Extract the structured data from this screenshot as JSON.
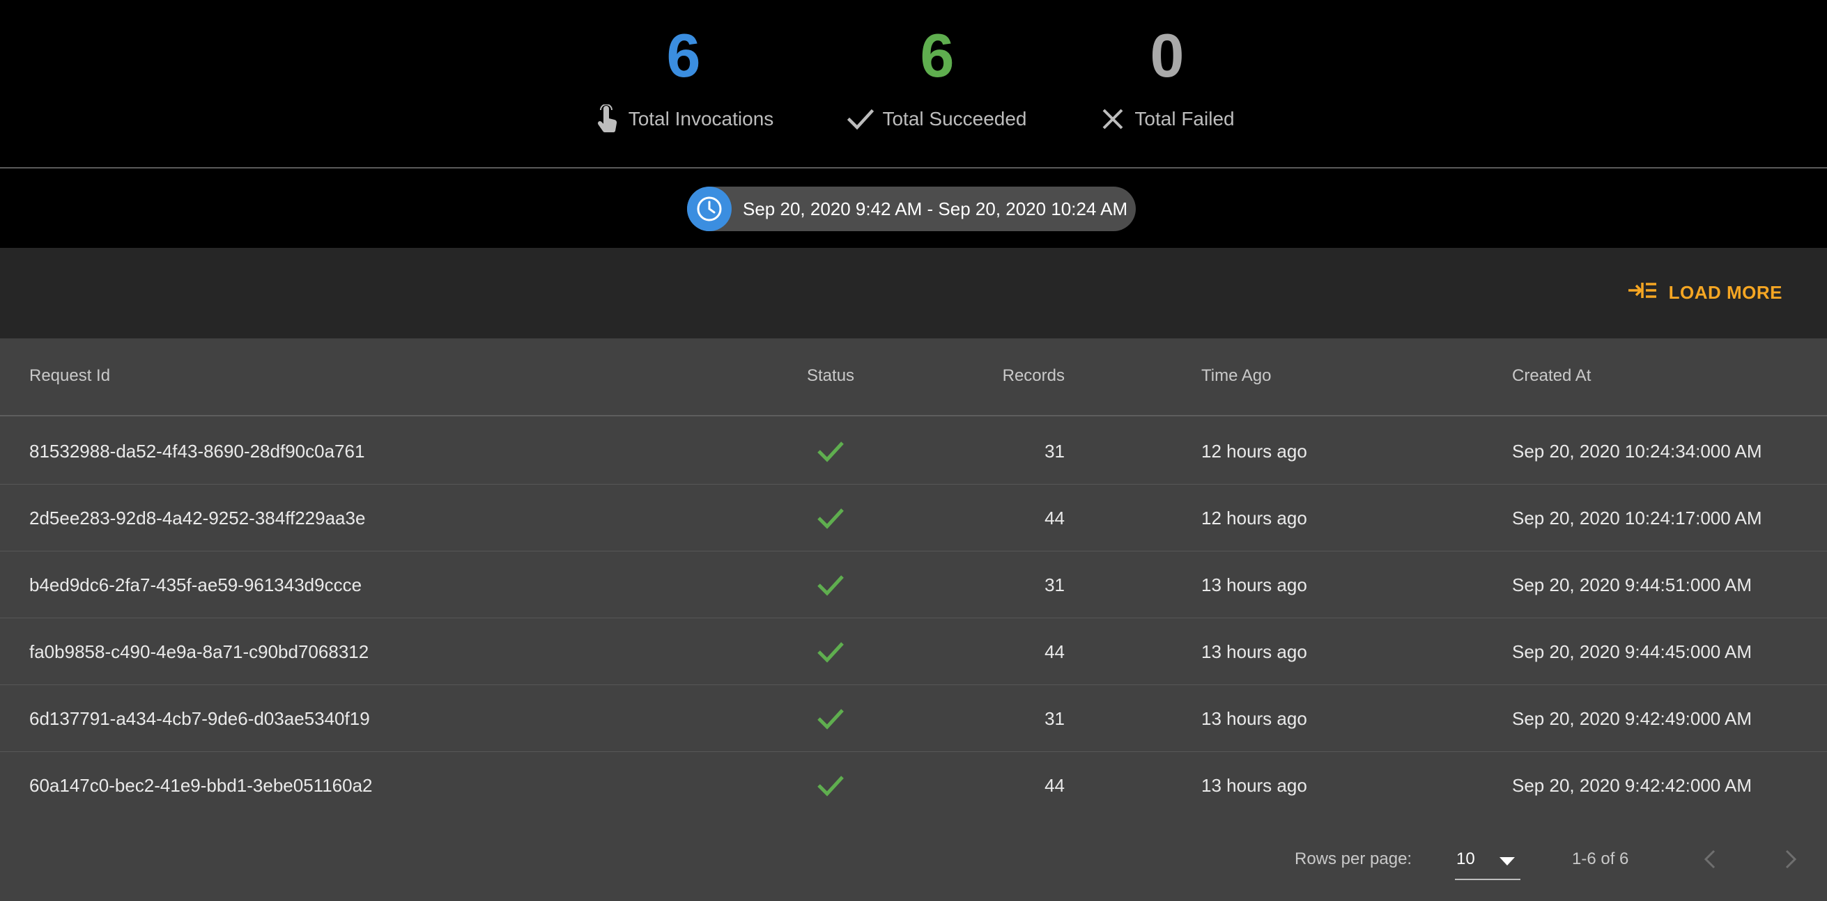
{
  "stats": {
    "invocations": {
      "value": "6",
      "label": "Total Invocations",
      "icon": "touch-icon",
      "color": "#3b8ee0"
    },
    "succeeded": {
      "value": "6",
      "label": "Total Succeeded",
      "icon": "check-icon",
      "color": "#5fae4f"
    },
    "failed": {
      "value": "0",
      "label": "Total Failed",
      "icon": "close-icon",
      "color": "#bdbdbd"
    }
  },
  "date_range": {
    "text": "Sep 20, 2020 9:42 AM - Sep 20, 2020 10:24 AM",
    "icon": "clock-icon"
  },
  "toolbar": {
    "load_more_label": "LOAD MORE",
    "icon": "load-more-icon",
    "accent": "#f5a623"
  },
  "table": {
    "headers": {
      "request_id": "Request Id",
      "status": "Status",
      "records": "Records",
      "time_ago": "Time Ago",
      "created_at": "Created At"
    },
    "rows": [
      {
        "request_id": "81532988-da52-4f43-8690-28df90c0a761",
        "status": "success",
        "records": "31",
        "time_ago": "12 hours ago",
        "created_at": "Sep 20, 2020 10:24:34:000 AM"
      },
      {
        "request_id": "2d5ee283-92d8-4a42-9252-384ff229aa3e",
        "status": "success",
        "records": "44",
        "time_ago": "12 hours ago",
        "created_at": "Sep 20, 2020 10:24:17:000 AM"
      },
      {
        "request_id": "b4ed9dc6-2fa7-435f-ae59-961343d9ccce",
        "status": "success",
        "records": "31",
        "time_ago": "13 hours ago",
        "created_at": "Sep 20, 2020 9:44:51:000 AM"
      },
      {
        "request_id": "fa0b9858-c490-4e9a-8a71-c90bd7068312",
        "status": "success",
        "records": "44",
        "time_ago": "13 hours ago",
        "created_at": "Sep 20, 2020 9:44:45:000 AM"
      },
      {
        "request_id": "6d137791-a434-4cb7-9de6-d03ae5340f19",
        "status": "success",
        "records": "31",
        "time_ago": "13 hours ago",
        "created_at": "Sep 20, 2020 9:42:49:000 AM"
      },
      {
        "request_id": "60a147c0-bec2-41e9-bbd1-3ebe051160a2",
        "status": "success",
        "records": "44",
        "time_ago": "13 hours ago",
        "created_at": "Sep 20, 2020 9:42:42:000 AM"
      }
    ]
  },
  "pagination": {
    "rows_per_page_label": "Rows per page:",
    "rows_per_page": "10",
    "range": "1-6 of 6"
  },
  "colors": {
    "success": "#5fae4f"
  }
}
